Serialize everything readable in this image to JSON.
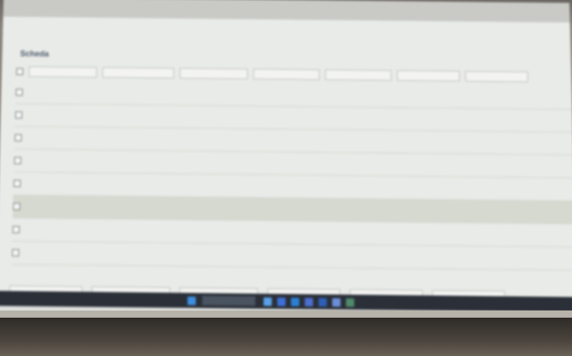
{
  "top_tabs": [
    "",
    "",
    "",
    "",
    "",
    ""
  ],
  "info_line": "",
  "section_title": "Scheda",
  "filters": [
    "",
    "",
    "",
    "",
    "",
    "",
    ""
  ],
  "rows": [
    {
      "c1": "",
      "c2": "",
      "c3": "",
      "c4": "",
      "c5": "",
      "c6": "",
      "c7": ""
    },
    {
      "c1": "",
      "c2": "",
      "c3": "",
      "c4": "",
      "c5": "",
      "c6": "",
      "c7": ""
    },
    {
      "c1": "",
      "c2": "",
      "c3": "",
      "c4": "",
      "c5": "",
      "c6": "",
      "c7": ""
    },
    {
      "c1": "",
      "c2": "",
      "c3": "",
      "c4": "",
      "c5": "",
      "c6": "",
      "c7": ""
    },
    {
      "c1": "",
      "c2": "",
      "c3": "",
      "c4": "",
      "c5": "",
      "c6": "",
      "c7": ""
    },
    {
      "c1": "",
      "c2": "",
      "c3": "",
      "c4": "",
      "c5": "",
      "c6": "",
      "c7": ""
    },
    {
      "c1": "",
      "c2": "",
      "c3": "",
      "c4": "",
      "c5": "",
      "c6": "",
      "c7": ""
    },
    {
      "c1": "",
      "c2": "",
      "c3": "",
      "c4": "",
      "c5": "",
      "c6": "",
      "c7": ""
    }
  ],
  "selected_row_index": 5,
  "bottom_title": "",
  "bottom_sub": "",
  "bottom_filters": [
    "",
    "",
    "",
    "",
    "",
    ""
  ],
  "taskbar": {
    "left_text": "",
    "search_placeholder": "",
    "right_text": ""
  },
  "colors": {
    "accent": "#4b5a6a",
    "selected_row": "#d5d9cf",
    "taskbar": "#2b3038"
  },
  "icons": [
    "windows-start-icon",
    "search-icon",
    "file-explorer-icon",
    "browser-icon",
    "mail-icon",
    "app-icon"
  ]
}
